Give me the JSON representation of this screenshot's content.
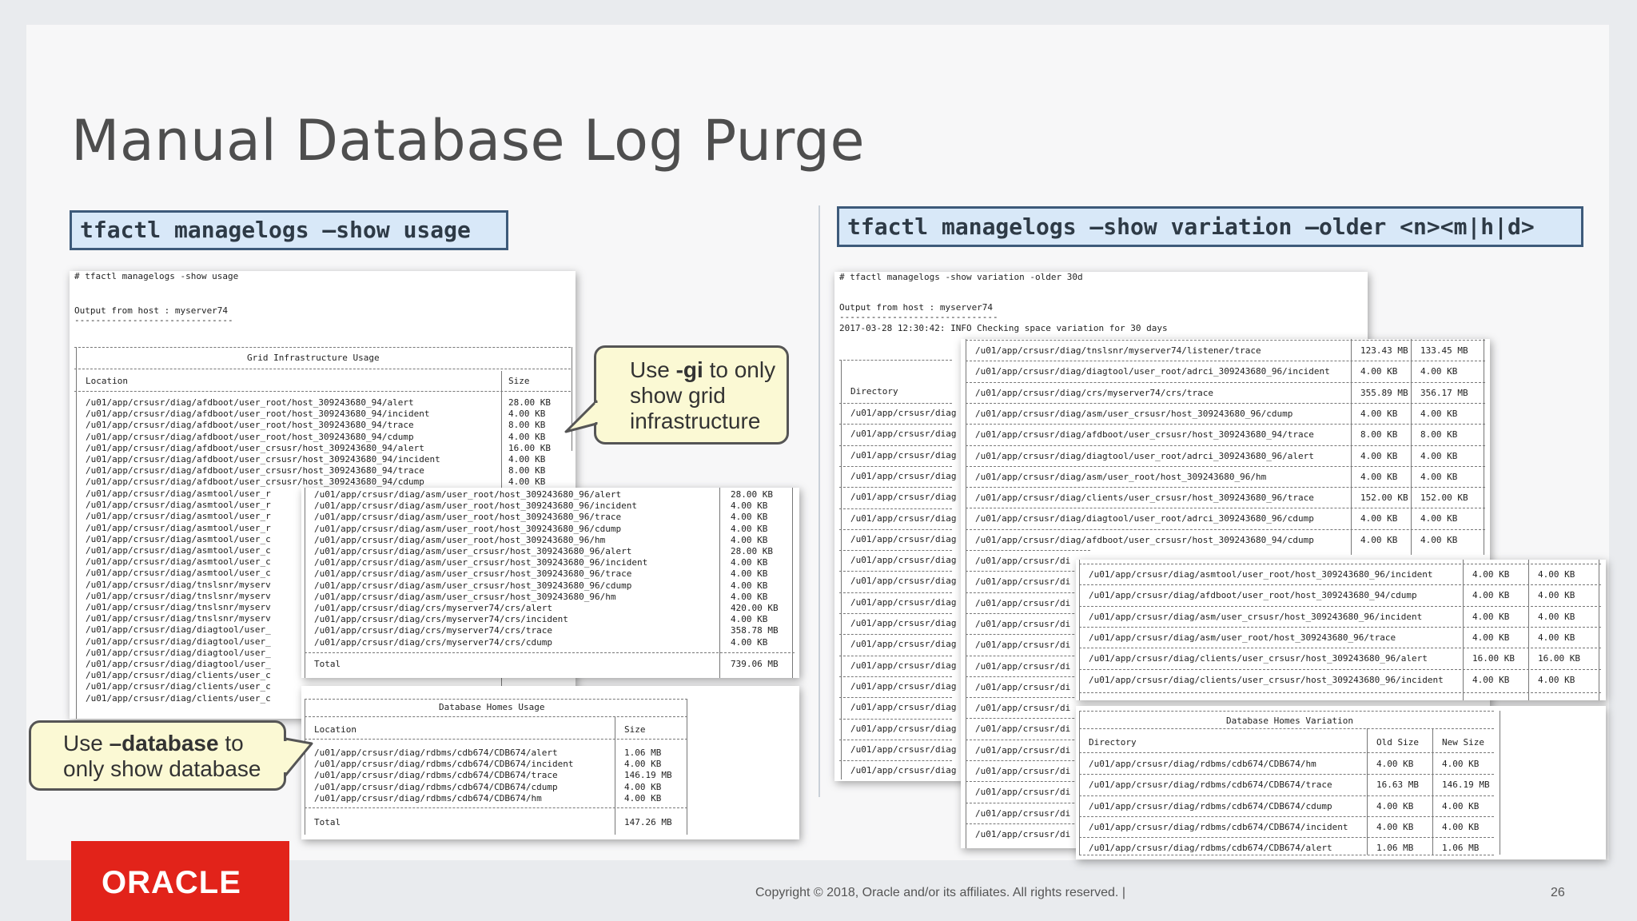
{
  "slide": {
    "title": "Manual Database Log Purge",
    "cmd_left": "tfactl managelogs –show usage",
    "cmd_right": "tfactl managelogs –show variation –older <n><m|h|d>",
    "copyright": "Copyright © 2018, Oracle and/or its affiliates. All rights reserved.  |",
    "page_number": "26",
    "logo": "ORACLE"
  },
  "callouts": {
    "gi": {
      "pre": "Use ",
      "bold": "-gi",
      "post": " to only show grid infrastructure"
    },
    "database": {
      "pre": "Use ",
      "bold": "–database",
      "post": " to only show database"
    }
  },
  "usage_output": {
    "command": "# tfactl managelogs -show usage",
    "host_line": "Output from host : myserver74",
    "host_underline": "------------------------------",
    "gi_title": "Grid Infrastructure Usage",
    "col_location": "Location",
    "col_size": "Size",
    "gi_rows": [
      {
        "path": "/u01/app/crsusr/diag/afdboot/user_root/host_309243680_94/alert",
        "size": "28.00 KB"
      },
      {
        "path": "/u01/app/crsusr/diag/afdboot/user_root/host_309243680_94/incident",
        "size": "4.00 KB"
      },
      {
        "path": "/u01/app/crsusr/diag/afdboot/user_root/host_309243680_94/trace",
        "size": "8.00 KB"
      },
      {
        "path": "/u01/app/crsusr/diag/afdboot/user_root/host_309243680_94/cdump",
        "size": "4.00 KB"
      },
      {
        "path": "/u01/app/crsusr/diag/afdboot/user_crsusr/host_309243680_94/alert",
        "size": "16.00 KB"
      },
      {
        "path": "/u01/app/crsusr/diag/afdboot/user_crsusr/host_309243680_94/incident",
        "size": "4.00 KB"
      },
      {
        "path": "/u01/app/crsusr/diag/afdboot/user_crsusr/host_309243680_94/trace",
        "size": "8.00 KB"
      },
      {
        "path": "/u01/app/crsusr/diag/afdboot/user_crsusr/host_309243680_94/cdump",
        "size": "4.00 KB"
      }
    ],
    "gi_hidden_rows": [
      "/u01/app/crsusr/diag/asmtool/user_r",
      "/u01/app/crsusr/diag/asmtool/user_r",
      "/u01/app/crsusr/diag/asmtool/user_r",
      "/u01/app/crsusr/diag/asmtool/user_r",
      "/u01/app/crsusr/diag/asmtool/user_c",
      "/u01/app/crsusr/diag/asmtool/user_c",
      "/u01/app/crsusr/diag/asmtool/user_c",
      "/u01/app/crsusr/diag/asmtool/user_c",
      "/u01/app/crsusr/diag/tnslsnr/myserv",
      "/u01/app/crsusr/diag/tnslsnr/myserv",
      "/u01/app/crsusr/diag/tnslsnr/myserv",
      "/u01/app/crsusr/diag/tnslsnr/myserv",
      "/u01/app/crsusr/diag/diagtool/user_",
      "/u01/app/crsusr/diag/diagtool/user_",
      "/u01/app/crsusr/diag/diagtool/user_",
      "/u01/app/crsusr/diag/diagtool/user_",
      "/u01/app/crsusr/diag/clients/user_c",
      "/u01/app/crsusr/diag/clients/user_c",
      "/u01/app/crsusr/diag/clients/user_c"
    ],
    "gi_rows_2": [
      {
        "path": "/u01/app/crsusr/diag/asm/user_root/host_309243680_96/alert",
        "size": "28.00 KB"
      },
      {
        "path": "/u01/app/crsusr/diag/asm/user_root/host_309243680_96/incident",
        "size": "4.00 KB"
      },
      {
        "path": "/u01/app/crsusr/diag/asm/user_root/host_309243680_96/trace",
        "size": "4.00 KB"
      },
      {
        "path": "/u01/app/crsusr/diag/asm/user_root/host_309243680_96/cdump",
        "size": "4.00 KB"
      },
      {
        "path": "/u01/app/crsusr/diag/asm/user_root/host_309243680_96/hm",
        "size": "4.00 KB"
      },
      {
        "path": "/u01/app/crsusr/diag/asm/user_crsusr/host_309243680_96/alert",
        "size": "28.00 KB"
      },
      {
        "path": "/u01/app/crsusr/diag/asm/user_crsusr/host_309243680_96/incident",
        "size": "4.00 KB"
      },
      {
        "path": "/u01/app/crsusr/diag/asm/user_crsusr/host_309243680_96/trace",
        "size": "4.00 KB"
      },
      {
        "path": "/u01/app/crsusr/diag/asm/user_crsusr/host_309243680_96/cdump",
        "size": "4.00 KB"
      },
      {
        "path": "/u01/app/crsusr/diag/asm/user_crsusr/host_309243680_96/hm",
        "size": "4.00 KB"
      },
      {
        "path": "/u01/app/crsusr/diag/crs/myserver74/crs/alert",
        "size": "420.00 KB"
      },
      {
        "path": "/u01/app/crsusr/diag/crs/myserver74/crs/incident",
        "size": "4.00 KB"
      },
      {
        "path": "/u01/app/crsusr/diag/crs/myserver74/crs/trace",
        "size": "358.78 MB"
      },
      {
        "path": "/u01/app/crsusr/diag/crs/myserver74/crs/cdump",
        "size": "4.00 KB"
      }
    ],
    "gi_total_label": "Total",
    "gi_total": "739.06 MB",
    "db_title": "Database Homes Usage",
    "db_rows": [
      {
        "path": "/u01/app/crsusr/diag/rdbms/cdb674/CDB674/alert",
        "size": "1.06 MB"
      },
      {
        "path": "/u01/app/crsusr/diag/rdbms/cdb674/CDB674/incident",
        "size": "4.00 KB"
      },
      {
        "path": "/u01/app/crsusr/diag/rdbms/cdb674/CDB674/trace",
        "size": "146.19 MB"
      },
      {
        "path": "/u01/app/crsusr/diag/rdbms/cdb674/CDB674/cdump",
        "size": "4.00 KB"
      },
      {
        "path": "/u01/app/crsusr/diag/rdbms/cdb674/CDB674/hm",
        "size": "4.00 KB"
      }
    ],
    "db_total_label": "Total",
    "db_total": "147.26 MB"
  },
  "variation_output": {
    "command": "# tfactl managelogs -show variation -older 30d",
    "host_line": "Output from host : myserver74",
    "host_underline": "------------------------------",
    "info_line": "2017-03-28 12:30:42: INFO Checking space variation for 30 days",
    "col_directory": "Directory",
    "col_old": "Old Size",
    "col_new": "New Size",
    "hidden_left": "/u01/app/crsusr/diag",
    "hidden_mid": "/u01/app/crsusr/di",
    "gi_rows": [
      {
        "path": "/u01/app/crsusr/diag/tnslsnr/myserver74/listener/trace",
        "old": "123.43 MB",
        "new": "133.45 MB"
      },
      {
        "path": "/u01/app/crsusr/diag/diagtool/user_root/adrci_309243680_96/incident",
        "old": "4.00 KB",
        "new": "4.00 KB"
      },
      {
        "path": "/u01/app/crsusr/diag/crs/myserver74/crs/trace",
        "old": "355.89 MB",
        "new": "356.17 MB"
      },
      {
        "path": "/u01/app/crsusr/diag/asm/user_crsusr/host_309243680_96/cdump",
        "old": "4.00 KB",
        "new": "4.00 KB"
      },
      {
        "path": "/u01/app/crsusr/diag/afdboot/user_crsusr/host_309243680_94/trace",
        "old": "8.00 KB",
        "new": "8.00 KB"
      },
      {
        "path": "/u01/app/crsusr/diag/diagtool/user_root/adrci_309243680_96/alert",
        "old": "4.00 KB",
        "new": "4.00 KB"
      },
      {
        "path": "/u01/app/crsusr/diag/asm/user_root/host_309243680_96/hm",
        "old": "4.00 KB",
        "new": "4.00 KB"
      },
      {
        "path": "/u01/app/crsusr/diag/clients/user_crsusr/host_309243680_96/trace",
        "old": "152.00 KB",
        "new": "152.00 KB"
      },
      {
        "path": "/u01/app/crsusr/diag/diagtool/user_root/adrci_309243680_96/cdump",
        "old": "4.00 KB",
        "new": "4.00 KB"
      },
      {
        "path": "/u01/app/crsusr/diag/afdboot/user_crsusr/host_309243680_94/cdump",
        "old": "4.00 KB",
        "new": "4.00 KB"
      }
    ],
    "gi_rows_2": [
      {
        "path": "/u01/app/crsusr/diag/asmtool/user_root/host_309243680_96/incident",
        "old": "4.00 KB",
        "new": "4.00 KB"
      },
      {
        "path": "/u01/app/crsusr/diag/afdboot/user_root/host_309243680_94/cdump",
        "old": "4.00 KB",
        "new": "4.00 KB"
      },
      {
        "path": "/u01/app/crsusr/diag/asm/user_crsusr/host_309243680_96/incident",
        "old": "4.00 KB",
        "new": "4.00 KB"
      },
      {
        "path": "/u01/app/crsusr/diag/asm/user_root/host_309243680_96/trace",
        "old": "4.00 KB",
        "new": "4.00 KB"
      },
      {
        "path": "/u01/app/crsusr/diag/clients/user_crsusr/host_309243680_96/alert",
        "old": "16.00 KB",
        "new": "16.00 KB"
      },
      {
        "path": "/u01/app/crsusr/diag/clients/user_crsusr/host_309243680_96/incident",
        "old": "4.00 KB",
        "new": "4.00 KB"
      }
    ],
    "db_title": "Database Homes Variation",
    "db_rows": [
      {
        "path": "/u01/app/crsusr/diag/rdbms/cdb674/CDB674/hm",
        "old": "4.00 KB",
        "new": "4.00 KB"
      },
      {
        "path": "/u01/app/crsusr/diag/rdbms/cdb674/CDB674/trace",
        "old": "16.63 MB",
        "new": "146.19 MB"
      },
      {
        "path": "/u01/app/crsusr/diag/rdbms/cdb674/CDB674/cdump",
        "old": "4.00 KB",
        "new": "4.00 KB"
      },
      {
        "path": "/u01/app/crsusr/diag/rdbms/cdb674/CDB674/incident",
        "old": "4.00 KB",
        "new": "4.00 KB"
      },
      {
        "path": "/u01/app/crsusr/diag/rdbms/cdb674/CDB674/alert",
        "old": "1.06 MB",
        "new": "1.06 MB"
      }
    ]
  }
}
